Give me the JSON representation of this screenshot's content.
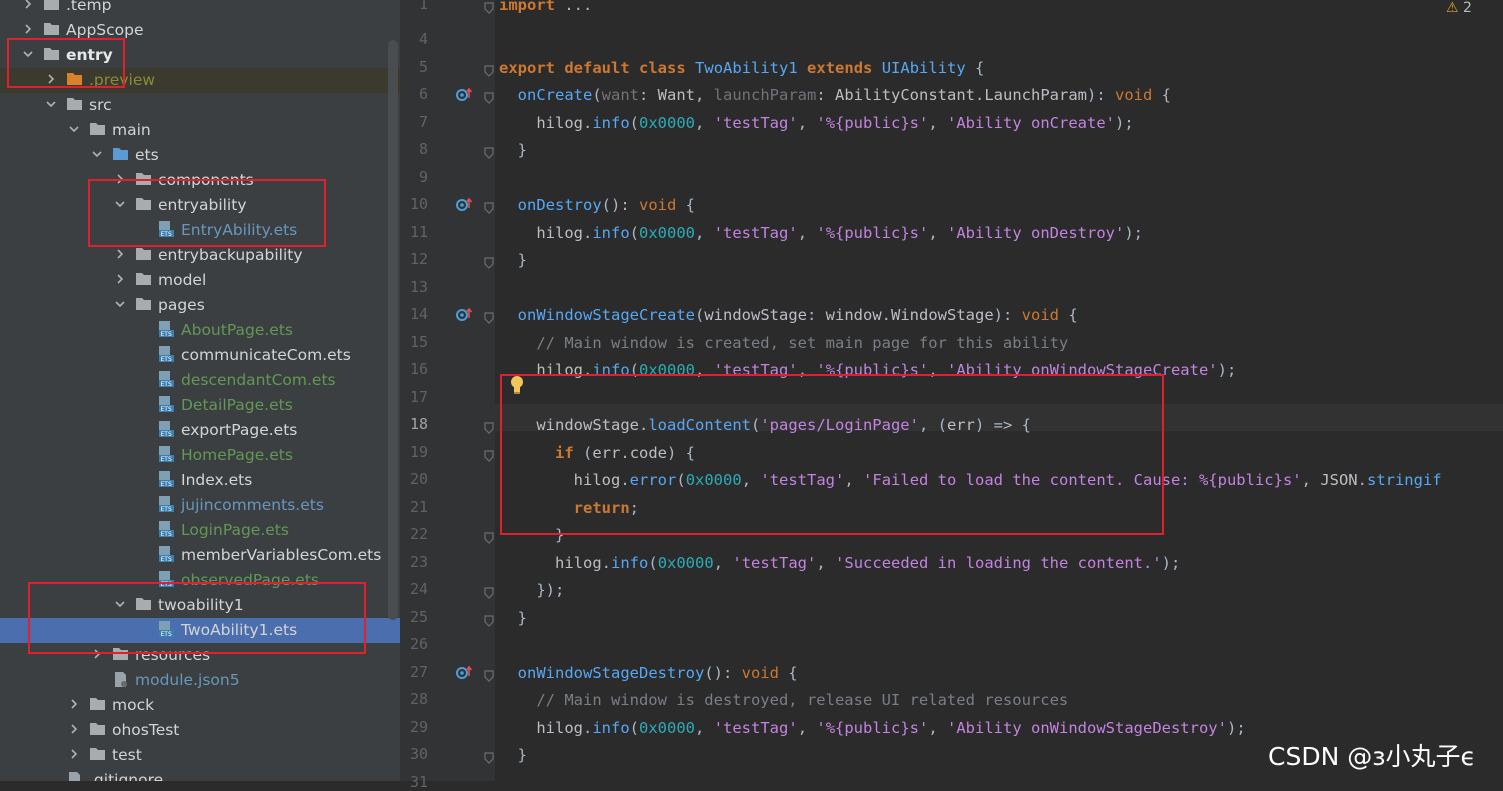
{
  "tree": {
    "items": [
      {
        "label": ".temp",
        "color": "white",
        "level": 0,
        "chev": "right",
        "icon": "folder-icon"
      },
      {
        "label": "AppScope",
        "color": "white",
        "level": 0,
        "chev": "right",
        "icon": "folder-icon"
      },
      {
        "label": "entry",
        "color": "bold",
        "level": 0,
        "chev": "down",
        "icon": "module-folder-icon"
      },
      {
        "label": ".preview",
        "color": "preview",
        "level": 1,
        "chev": "right",
        "icon": "orange-folder-icon"
      },
      {
        "label": "src",
        "color": "white",
        "level": 1,
        "chev": "down",
        "icon": "folder-icon"
      },
      {
        "label": "main",
        "color": "white",
        "level": 2,
        "chev": "down",
        "icon": "folder-icon"
      },
      {
        "label": "ets",
        "color": "white",
        "level": 3,
        "chev": "down",
        "icon": "blue-folder-icon"
      },
      {
        "label": "components",
        "color": "white",
        "level": 4,
        "chev": "right",
        "icon": "folder-icon"
      },
      {
        "label": "entryability",
        "color": "white",
        "level": 4,
        "chev": "down",
        "icon": "folder-icon"
      },
      {
        "label": "EntryAbility.ets",
        "color": "blue",
        "level": 5,
        "chev": "",
        "icon": "ets-file-icon"
      },
      {
        "label": "entrybackupability",
        "color": "white",
        "level": 4,
        "chev": "right",
        "icon": "folder-icon"
      },
      {
        "label": "model",
        "color": "white",
        "level": 4,
        "chev": "right",
        "icon": "folder-icon"
      },
      {
        "label": "pages",
        "color": "white",
        "level": 4,
        "chev": "down",
        "icon": "folder-icon"
      },
      {
        "label": "AboutPage.ets",
        "color": "green",
        "level": 5,
        "chev": "",
        "icon": "ets-file-icon"
      },
      {
        "label": "communicateCom.ets",
        "color": "white",
        "level": 5,
        "chev": "",
        "icon": "ets-file-icon"
      },
      {
        "label": "descendantCom.ets",
        "color": "green",
        "level": 5,
        "chev": "",
        "icon": "ets-file-icon"
      },
      {
        "label": "DetailPage.ets",
        "color": "green",
        "level": 5,
        "chev": "",
        "icon": "ets-file-icon"
      },
      {
        "label": "exportPage.ets",
        "color": "white",
        "level": 5,
        "chev": "",
        "icon": "ets-file-icon"
      },
      {
        "label": "HomePage.ets",
        "color": "green",
        "level": 5,
        "chev": "",
        "icon": "ets-file-icon"
      },
      {
        "label": "Index.ets",
        "color": "white",
        "level": 5,
        "chev": "",
        "icon": "ets-file-icon"
      },
      {
        "label": "jujincomments.ets",
        "color": "blue",
        "level": 5,
        "chev": "",
        "icon": "ets-file-icon"
      },
      {
        "label": "LoginPage.ets",
        "color": "green",
        "level": 5,
        "chev": "",
        "icon": "ets-file-icon"
      },
      {
        "label": "memberVariablesCom.ets",
        "color": "white",
        "level": 5,
        "chev": "",
        "icon": "ets-file-icon"
      },
      {
        "label": "observedPage.ets",
        "color": "green",
        "level": 5,
        "chev": "",
        "icon": "ets-file-icon"
      },
      {
        "label": "twoability1",
        "color": "white",
        "level": 4,
        "chev": "down",
        "icon": "folder-icon"
      },
      {
        "label": "TwoAbility1.ets",
        "color": "white",
        "level": 5,
        "chev": "",
        "icon": "ets-file-icon",
        "selected": true
      },
      {
        "label": "resources",
        "color": "white",
        "level": 3,
        "chev": "right",
        "icon": "folder-icon"
      },
      {
        "label": "module.json5",
        "color": "blue",
        "level": 3,
        "chev": "",
        "icon": "json-file-icon"
      },
      {
        "label": "mock",
        "color": "white",
        "level": 2,
        "chev": "right",
        "icon": "folder-icon"
      },
      {
        "label": "ohosTest",
        "color": "white",
        "level": 2,
        "chev": "right",
        "icon": "folder-icon"
      },
      {
        "label": "test",
        "color": "white",
        "level": 2,
        "chev": "right",
        "icon": "folder-icon"
      },
      {
        "label": ".gitignore",
        "color": "white",
        "level": 1,
        "chev": "",
        "icon": "file-icon"
      }
    ]
  },
  "editor": {
    "warning_count": "2",
    "current_line": "18",
    "lines": [
      {
        "n": "1",
        "code": "import ..."
      },
      {
        "n": "4",
        "code": ""
      },
      {
        "n": "5",
        "code": "export default class TwoAbility1 extends UIAbility {"
      },
      {
        "n": "6",
        "code": "  onCreate(want: Want, launchParam: AbilityConstant.LaunchParam): void {"
      },
      {
        "n": "7",
        "code": "    hilog.info(0x0000, 'testTag', '%{public}s', 'Ability onCreate');"
      },
      {
        "n": "8",
        "code": "  }"
      },
      {
        "n": "9",
        "code": ""
      },
      {
        "n": "10",
        "code": "  onDestroy(): void {"
      },
      {
        "n": "11",
        "code": "    hilog.info(0x0000, 'testTag', '%{public}s', 'Ability onDestroy');"
      },
      {
        "n": "12",
        "code": "  }"
      },
      {
        "n": "13",
        "code": ""
      },
      {
        "n": "14",
        "code": "  onWindowStageCreate(windowStage: window.WindowStage): void {"
      },
      {
        "n": "15",
        "code": "    // Main window is created, set main page for this ability"
      },
      {
        "n": "16",
        "code": "    hilog.info(0x0000, 'testTag', '%{public}s', 'Ability onWindowStageCreate');"
      },
      {
        "n": "17",
        "code": ""
      },
      {
        "n": "18",
        "code": "    windowStage.loadContent('pages/LoginPage', (err) => {"
      },
      {
        "n": "19",
        "code": "      if (err.code) {"
      },
      {
        "n": "20",
        "code": "        hilog.error(0x0000, 'testTag', 'Failed to load the content. Cause: %{public}s', JSON.stringif"
      },
      {
        "n": "21",
        "code": "        return;"
      },
      {
        "n": "22",
        "code": "      }"
      },
      {
        "n": "23",
        "code": "      hilog.info(0x0000, 'testTag', 'Succeeded in loading the content.');"
      },
      {
        "n": "24",
        "code": "    });"
      },
      {
        "n": "25",
        "code": "  }"
      },
      {
        "n": "26",
        "code": ""
      },
      {
        "n": "27",
        "code": "  onWindowStageDestroy(): void {"
      },
      {
        "n": "28",
        "code": "    // Main window is destroyed, release UI related resources"
      },
      {
        "n": "29",
        "code": "    hilog.info(0x0000, 'testTag', '%{public}s', 'Ability onWindowStageDestroy');"
      },
      {
        "n": "30",
        "code": "  }"
      },
      {
        "n": "31",
        "code": ""
      }
    ]
  },
  "watermark": "CSDN @з小丸子ϵ"
}
